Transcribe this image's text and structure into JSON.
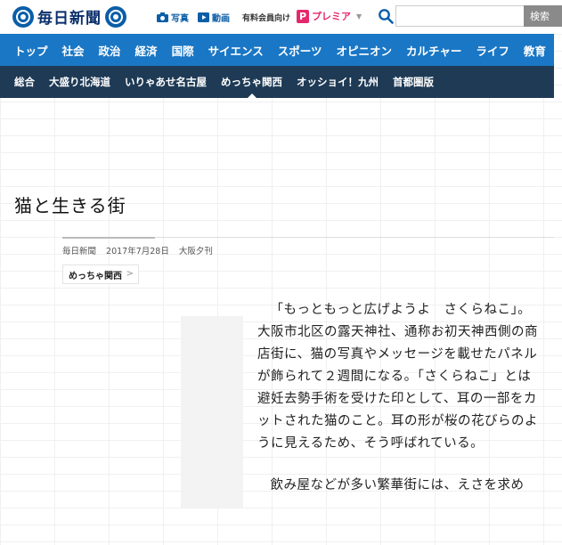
{
  "header": {
    "logo_text": "毎日新聞",
    "links": [
      {
        "label": "写真",
        "icon": "camera-icon"
      },
      {
        "label": "動画",
        "icon": "video-play-icon"
      }
    ],
    "member_label": "有料会員向け",
    "premier_mark": "P",
    "premier_label": "プレミア",
    "search": {
      "placeholder": "",
      "value": "",
      "button_label": "検索"
    }
  },
  "nav": {
    "main": [
      "トップ",
      "社会",
      "政治",
      "経済",
      "国際",
      "サイエンス",
      "スポーツ",
      "オピニオン",
      "カルチャー",
      "ライフ",
      "教育"
    ],
    "sub": [
      "総合",
      "大盛り北海道",
      "いりゃあせ名古屋",
      "めっちゃ関西",
      "オッショイ！九州",
      "首都圏版"
    ],
    "sub_active_index": 3
  },
  "article": {
    "title": "猫と生きる街",
    "source": "毎日新聞",
    "date": "2017年7月28日",
    "edition": "大阪夕刊",
    "tag": "めっちゃ関西",
    "paragraphs": [
      "「もっともっと広げようよ　さくらねこ」。大阪市北区の露天神社、通称お初天神西側の商店街に、猫の写真やメッセージを載せたパネルが飾られて２週間になる。「さくらねこ」とは避妊去勢手術を受けた印として、耳の一部をカットされた猫のこと。耳の形が桜の花びらのように見えるため、そう呼ばれている。",
      "飲み屋などが多い繁華街には、えさを求め"
    ]
  },
  "colors": {
    "brand_blue": "#1a77c5",
    "sub_nav": "#1e3a55",
    "logo_blue": "#0a5ea8",
    "premier_pink": "#e5276c"
  }
}
